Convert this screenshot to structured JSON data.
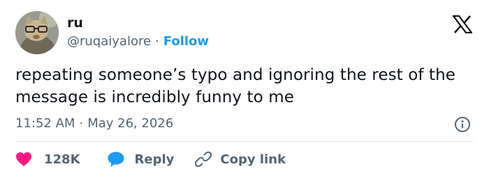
{
  "author": {
    "display_name": "ru",
    "handle": "@ruqaiyalore",
    "separator": "·",
    "follow_label": "Follow"
  },
  "tweet": {
    "text": "repeating someone’s typo and ignoring the rest of the message is incredibly funny to me",
    "time": "11:52 AM",
    "separator": "·",
    "date": "May 26, 2026"
  },
  "actions": {
    "like_count": "128K",
    "reply_label": "Reply",
    "copy_link_label": "Copy link"
  },
  "icons": {
    "logo": "x-logo-icon",
    "info": "info-icon",
    "like": "heart-icon",
    "reply": "speech-bubble-icon",
    "copy": "link-icon"
  },
  "colors": {
    "text": "#0f1419",
    "secondary": "#536471",
    "follow": "#1d9bf0",
    "heart": "#f91880",
    "reply_bubble": "#1d9bf0",
    "divider": "#e1e8ed"
  }
}
